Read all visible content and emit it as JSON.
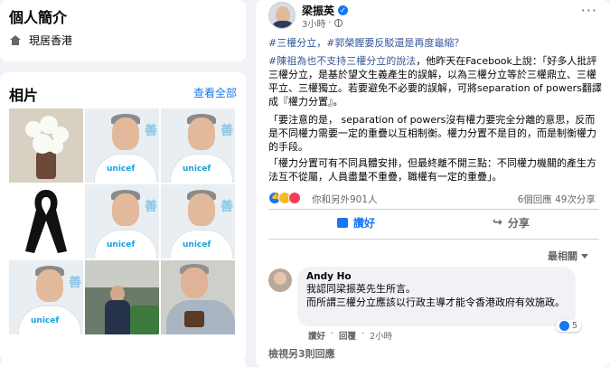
{
  "intro": {
    "title": "個人簡介",
    "location_icon": "home-icon",
    "location": "現居香港"
  },
  "photos": {
    "title": "相片",
    "see_all": "查看全部"
  },
  "post": {
    "author": "梁振英",
    "verified_icon": "verified-badge-icon",
    "time": "3小時",
    "privacy_icon": "globe-icon",
    "more": "···",
    "hashtags": "#三權分立，#郭榮鏗要反駁還是再度龜縮？",
    "para1_link": "#陳祖為也不支持三權分立的說法",
    "para1_rest": "，他昨天在Facebook上說：「好多人批評三權分立，是基於望文生義產生的誤解，以為三權分立等於三權鼎立、三權平立、三權獨立。若要避免不必要的誤解，可將separation of powers翻譯成『權力分置』。",
    "para2": "「要注意的是，  separation of powers沒有權力要完全分離的意思，反而是不同權力需要一定的重疊以互相制衡。權力分置不是目的，而是制衡權力的手段。",
    "para3": "「權力分置可有不同具體安排，但最終離不開三點：不同權力機關的產生方法互不從屬，人員盡量不重疊，職權有一定的重疊」。",
    "reactions_text": "你和另外901人",
    "comments_count": "6個回應",
    "shares_count": "49次分享",
    "like_label": "讚好",
    "share_label": "分享"
  },
  "comments": {
    "sort_label": "最相關",
    "items": [
      {
        "name": "Andy Ho",
        "line1": "我認同梁振英先生所言。",
        "line2": "而所謂三權分立應該以行政主導才能令香港政府有效施政。",
        "reaction_count": "5",
        "like": "讚好",
        "reply": "回覆",
        "time": "2小時"
      }
    ],
    "more_replies": "檢視另3則回應"
  },
  "colors": {
    "accent": "#1877f2",
    "link": "#385898",
    "muted": "#65676b",
    "background": "#f0f2f5"
  }
}
